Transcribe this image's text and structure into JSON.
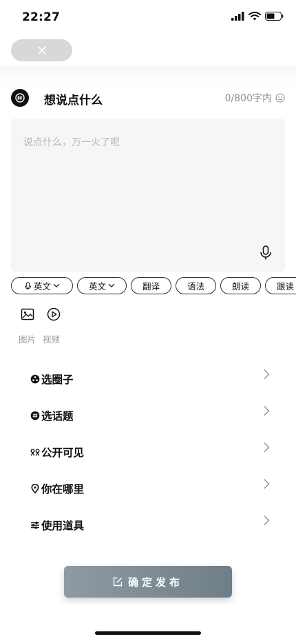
{
  "status_bar": {
    "time": "22:27"
  },
  "composer": {
    "prompt_title": "想说点什么",
    "counter": "0/800字内",
    "placeholder": "说点什么，万一火了呢"
  },
  "chips": [
    {
      "label": "英文",
      "has_mic": true,
      "has_chevron": true,
      "width": 90
    },
    {
      "label": "英文",
      "has_mic": false,
      "has_chevron": true,
      "width": 72
    },
    {
      "label": "翻译",
      "has_mic": false,
      "has_chevron": false,
      "width": 59
    },
    {
      "label": "语法",
      "has_mic": false,
      "has_chevron": false,
      "width": 59
    },
    {
      "label": "朗读",
      "has_mic": false,
      "has_chevron": false,
      "width": 59
    },
    {
      "label": "跟读",
      "has_mic": false,
      "has_chevron": false,
      "width": 59
    }
  ],
  "media": {
    "image_label": "图片",
    "video_label": "视频"
  },
  "menu": [
    {
      "label": "选圈子",
      "icon": "circle-group-icon"
    },
    {
      "label": "选话题",
      "icon": "topic-icon"
    },
    {
      "label": "公开可见",
      "icon": "visibility-icon"
    },
    {
      "label": "你在哪里",
      "icon": "location-pin-icon"
    },
    {
      "label": "使用道具",
      "icon": "props-sliders-icon"
    }
  ],
  "publish": {
    "label": "确定发布"
  }
}
